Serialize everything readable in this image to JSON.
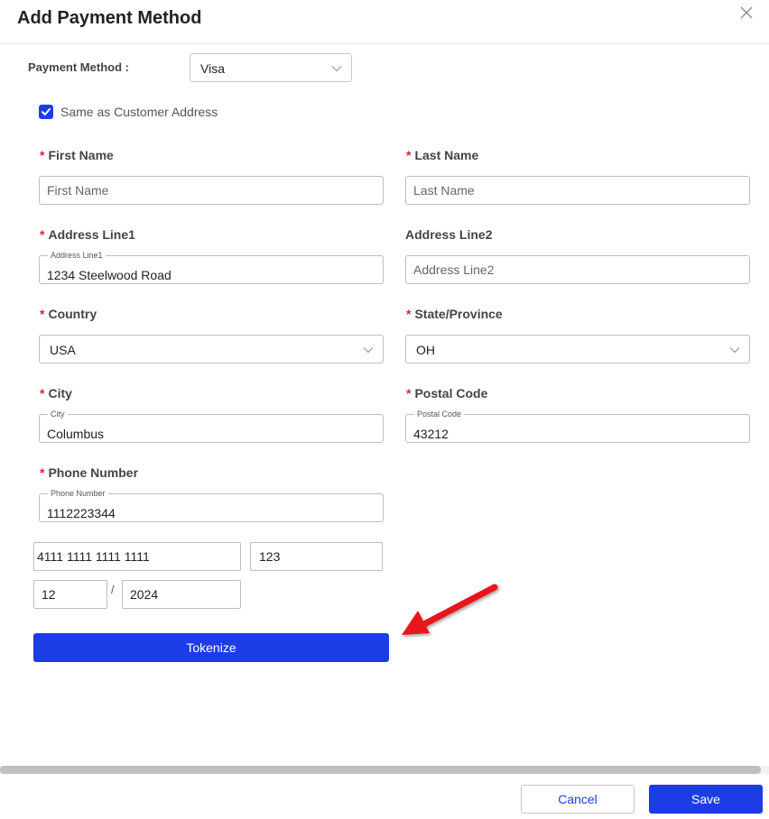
{
  "dialog": {
    "title": "Add Payment Method"
  },
  "payment_method": {
    "label": "Payment Method :",
    "value": "Visa"
  },
  "same_address": {
    "label": "Same as Customer Address",
    "checked": true
  },
  "fields": {
    "first_name": {
      "label": "First Name",
      "placeholder": "First Name",
      "value": "",
      "required": true
    },
    "last_name": {
      "label": "Last Name",
      "placeholder": "Last Name",
      "value": "",
      "required": true
    },
    "address_line1": {
      "label": "Address Line1",
      "float_label": "Address Line1",
      "value": "1234 Steelwood Road",
      "required": true
    },
    "address_line2": {
      "label": "Address Line2",
      "placeholder": "Address Line2",
      "value": "",
      "required": false
    },
    "country": {
      "label": "Country",
      "value": "USA",
      "required": true
    },
    "state": {
      "label": "State/Province",
      "value": "OH",
      "required": true
    },
    "city": {
      "label": "City",
      "float_label": "City",
      "value": "Columbus",
      "required": true
    },
    "postal_code": {
      "label": "Postal Code",
      "float_label": "Postal Code",
      "value": "43212",
      "required": true
    },
    "phone": {
      "label": "Phone Number",
      "float_label": "Phone Number",
      "value": "1112223344",
      "required": true
    }
  },
  "card": {
    "number": "4111 1111 1111 1111",
    "cvv": "123",
    "exp_month": "12",
    "separator": "/",
    "exp_year": "2024"
  },
  "buttons": {
    "tokenize": "Tokenize",
    "cancel": "Cancel",
    "save": "Save"
  },
  "icons": {
    "close": "close-icon",
    "chevron": "chevron-down-icon",
    "check": "check-icon",
    "arrow": "red-arrow-annotation"
  },
  "colors": {
    "accent": "#1c3de6",
    "required": "#d8262d",
    "arrow": "#e8191f"
  }
}
